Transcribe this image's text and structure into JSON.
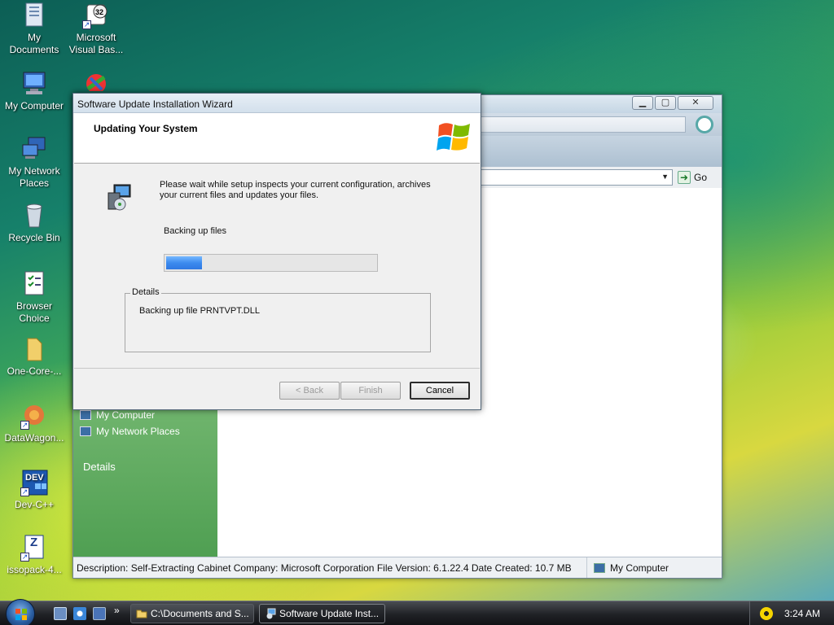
{
  "desktop": {
    "icons": [
      {
        "label": "My\nDocuments",
        "icon": "documents-icon"
      },
      {
        "label": "Microsoft\nVisual Bas...",
        "icon": "vb-icon"
      },
      {
        "label": "My Computer",
        "icon": "computer-icon"
      },
      {
        "label": "My Network\nPlaces",
        "icon": "network-icon"
      },
      {
        "label": "Recycle Bin",
        "icon": "recycle-bin-icon"
      },
      {
        "label": "Browser\nChoice",
        "icon": "browser-choice-icon"
      },
      {
        "label": "One-Core-...",
        "icon": "folder-icon"
      },
      {
        "label": "DataWagon...",
        "icon": "datawagon-icon"
      },
      {
        "label": "Dev-C++",
        "icon": "devcpp-icon"
      },
      {
        "label": "issopack-4...",
        "icon": "zip-icon"
      }
    ],
    "dev_badge": "DEV",
    "vb_badge": "32",
    "zip_badge": "Z"
  },
  "explorer": {
    "go_label": "Go",
    "sidebar_links": [
      "My Computer",
      "My Network Places"
    ],
    "details_heading": "Details",
    "status_description": "Description: Self-Extracting Cabinet Company: Microsoft Corporation File Version: 6.1.22.4 Date Created: 10.7 MB",
    "status_zone": "My Computer"
  },
  "wizard": {
    "title": "Software Update Installation Wizard",
    "heading": "Updating Your System",
    "message": "Please wait while setup inspects your current configuration, archives your current files and updates your files.",
    "status": "Backing up files",
    "progress": 0.17,
    "details_label": "Details",
    "details_text": "Backing up file PRNTVPT.DLL",
    "buttons": {
      "back": "< Back",
      "finish": "Finish",
      "cancel": "Cancel"
    }
  },
  "taskbar": {
    "tasks": [
      {
        "label": "C:\\Documents and S..."
      },
      {
        "label": "Software Update Inst..."
      }
    ],
    "quicklaunch_more": "»",
    "clock": "3:24 AM"
  }
}
